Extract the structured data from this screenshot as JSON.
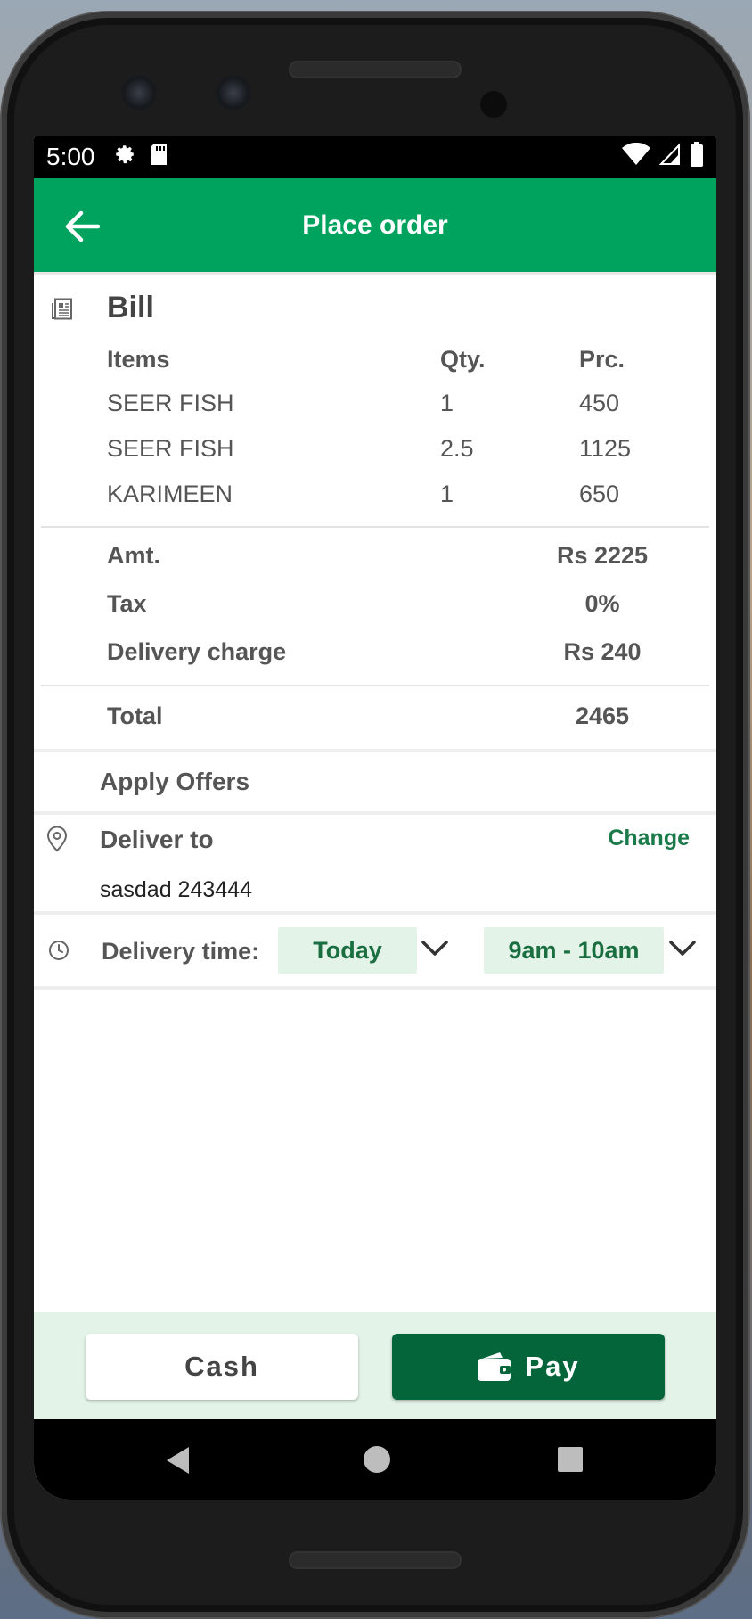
{
  "status_bar": {
    "time": "5:00",
    "icons": [
      "gear-icon",
      "sd-card-icon",
      "wifi-icon",
      "signal-icon",
      "battery-icon"
    ]
  },
  "app_bar": {
    "title": "Place order",
    "back_icon": "arrow-left-icon"
  },
  "bill": {
    "title": "Bill",
    "headers": {
      "items": "Items",
      "qty": "Qty.",
      "price": "Prc."
    },
    "items": [
      {
        "name": "SEER FISH",
        "qty": "1",
        "price": "450"
      },
      {
        "name": "SEER FISH",
        "qty": "2.5",
        "price": "1125"
      },
      {
        "name": "KARIMEEN",
        "qty": "1",
        "price": "650"
      }
    ],
    "amount": {
      "label": "Amt.",
      "value": "Rs 2225"
    },
    "tax": {
      "label": "Tax",
      "value": "0%"
    },
    "delivery_charge": {
      "label": "Delivery charge",
      "value": "Rs 240"
    },
    "total": {
      "label": "Total",
      "value": "2465"
    }
  },
  "offers": {
    "label": "Apply Offers"
  },
  "deliver": {
    "label": "Deliver to",
    "change_label": "Change",
    "address": "sasdad 243444"
  },
  "delivery_time": {
    "label": "Delivery time:",
    "day": "Today",
    "slot": "9am - 10am"
  },
  "footer": {
    "cash_label": "Cash",
    "pay_label": "Pay"
  },
  "colors": {
    "primary": "#00a35e",
    "dark_green": "#04653a",
    "pill_bg": "#e3f3e8",
    "link_green": "#1a7a49"
  }
}
